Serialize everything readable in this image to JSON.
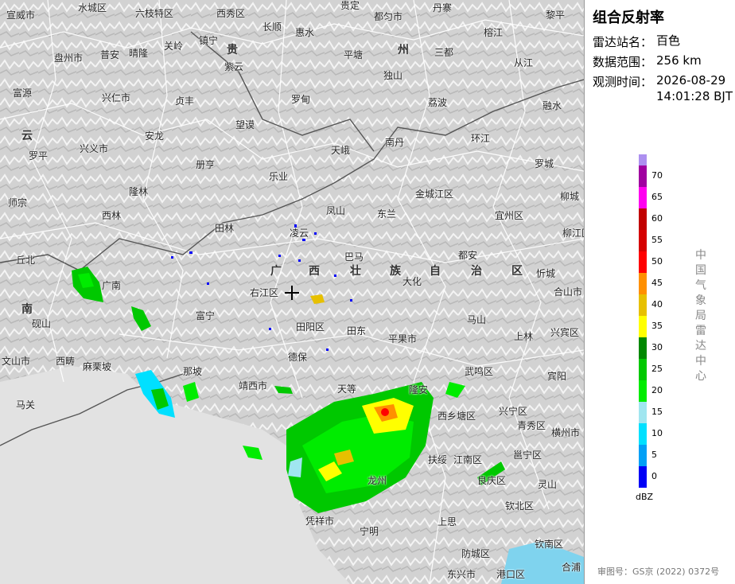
{
  "header": {
    "title": "组合反射率",
    "station_label": "雷达站名：",
    "station_value": "百色",
    "range_label": "数据范围：",
    "range_value": "256 km",
    "time_label": "观测时间：",
    "time_date": "2026-08-29",
    "time_clock": "14:01:28 BJT"
  },
  "legend": {
    "unit": "dBZ",
    "ticks": [
      "70",
      "65",
      "60",
      "55",
      "50",
      "45",
      "40",
      "35",
      "30",
      "25",
      "20",
      "15",
      "10",
      "5",
      "0"
    ],
    "colors": [
      "#ad90f0",
      "#a000a0",
      "#ff00f0",
      "#c10000",
      "#d60000",
      "#ff0000",
      "#ff9000",
      "#e7c000",
      "#ffff00",
      "#008800",
      "#00c800",
      "#00ec00",
      "#a0e6f0",
      "#00e0ff",
      "#01a0f6",
      "#0000f6"
    ]
  },
  "agency": "中国气象局雷达中心",
  "review_no": "审图号：GS京 (2022) 0372号",
  "map": {
    "radar_center_icon": "crosshair-icon",
    "regions": [
      "贵",
      "州",
      "云",
      "南",
      "广",
      "西",
      "壮",
      "族",
      "自",
      "治",
      "区"
    ],
    "places": [
      "宣威市",
      "水城区",
      "六枝特区",
      "西秀区",
      "贵定",
      "都匀市",
      "丹寨",
      "黎平",
      "盘州市",
      "普安",
      "晴隆",
      "关岭",
      "镇宁",
      "紫云",
      "长顺",
      "惠水",
      "平塘",
      "独山",
      "三都",
      "榕江",
      "从江",
      "富源",
      "兴仁市",
      "贞丰",
      "罗甸",
      "荔波",
      "融水",
      "罗平",
      "兴义市",
      "安龙",
      "望谟",
      "南丹",
      "环江",
      "师宗",
      "隆林",
      "册亨",
      "乐业",
      "天峨",
      "金城江区",
      "罗城",
      "西林",
      "田林",
      "凤山",
      "东兰",
      "宜州区",
      "柳城",
      "丘北",
      "广南",
      "凌云",
      "巴马",
      "都安",
      "大化",
      "忻城",
      "柳江区",
      "砚山",
      "富宁",
      "右江区",
      "田阳区",
      "田东",
      "马山",
      "上林",
      "合山市",
      "兴宾区",
      "文山市",
      "西畴",
      "麻栗坡",
      "那坡",
      "德保",
      "平果市",
      "宾阳",
      "马关",
      "靖西市",
      "天等",
      "隆安",
      "武鸣区",
      "西乡塘区",
      "兴宁区",
      "青秀区",
      "横州市",
      "扶绥",
      "江南区",
      "邕宁区",
      "良庆区",
      "灵山",
      "龙州",
      "宁明",
      "上思",
      "钦北区",
      "凭祥市",
      "防城区",
      "钦南区",
      "东兴市",
      "港口区",
      "合浦"
    ]
  }
}
